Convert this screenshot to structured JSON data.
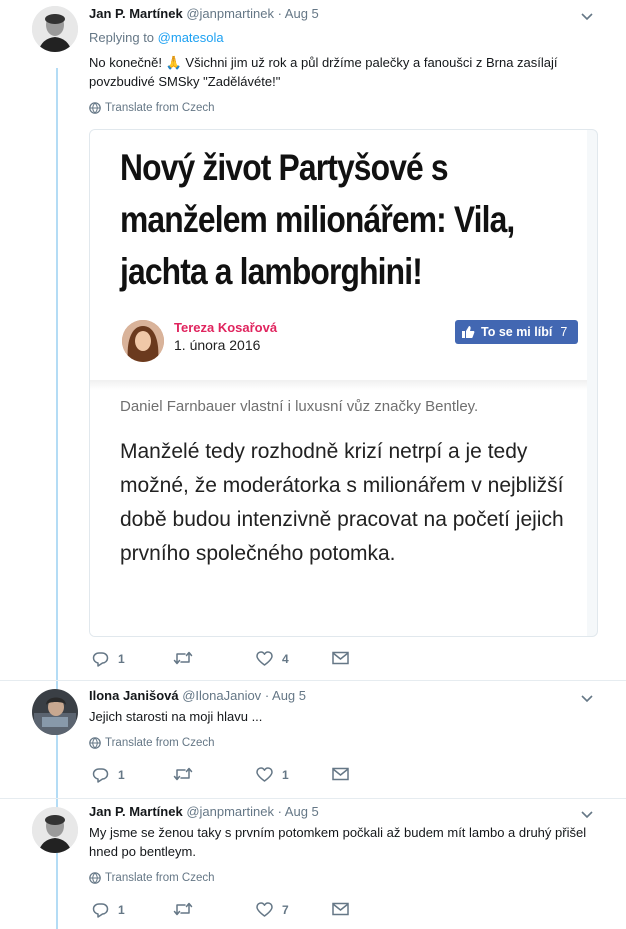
{
  "tweet1": {
    "name": "Jan P. Martínek",
    "handle": "@janpmartinek",
    "date": "· Aug 5",
    "replying_prefix": "Replying to",
    "replying_handle": "@matesola",
    "text": "No konečně! 🙏 Všichni jim už rok a půl držíme palečky a fanoušci z Brna zasílají povzbudivé SMSky \"Zadělávéte!\"",
    "translate": "Translate from Czech",
    "replies": "1",
    "retweets": "",
    "likes": "4"
  },
  "card": {
    "headline_lines": [
      "Nový život Partyšové s",
      "manželem milionářem: Vila,",
      "jachta a lamborghini!"
    ],
    "author": "Tereza Kosařová",
    "date": "1. února 2016",
    "like_label": "To se mi líbí",
    "like_count": "7",
    "caption": "Daniel Farnbauer vlastní i luxusní vůz značky Bentley.",
    "body": "Manželé tedy rozhodně krizí netrpí a je tedy možné, že moderátorka s milionářem v nejbližší době budou intenzivně pracovat na početí jejich prvního společného potomka."
  },
  "tweet2": {
    "name": "Ilona Janišová",
    "handle": "@IlonaJaniov",
    "date": "· Aug 5",
    "text": "Jejich starosti na moji hlavu ...",
    "translate": "Translate from Czech",
    "replies": "1",
    "retweets": "",
    "likes": "1"
  },
  "tweet3": {
    "name": "Jan P. Martínek",
    "handle": "@janpmartinek",
    "date": "· Aug 5",
    "text": "My jsme se ženou taky s prvním potomkem počkali až budem mít lambo a druhý přišel hned po bentleym.",
    "translate": "Translate from Czech",
    "replies": "1",
    "retweets": "",
    "likes": "7"
  },
  "colors": {
    "link": "#1da1f2",
    "muted": "#657786",
    "thread": "#b4dcf5",
    "fb_blue": "#4267b2",
    "author_pink": "#e0245e"
  }
}
